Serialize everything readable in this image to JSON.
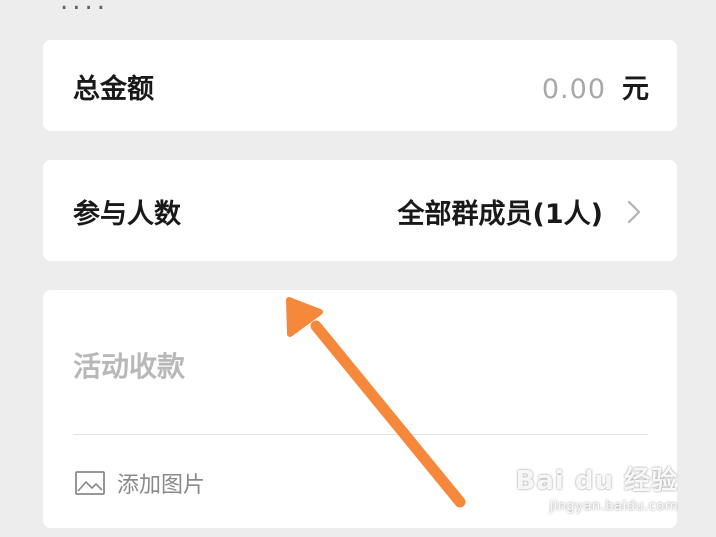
{
  "header": {
    "partial_title": "...."
  },
  "amount": {
    "label": "总金额",
    "value": "0.00",
    "unit": "元"
  },
  "participants": {
    "label": "参与人数",
    "value": "全部群成员(1人)"
  },
  "note": {
    "placeholder": "活动收款",
    "add_image_label": "添加图片"
  },
  "watermark": {
    "brand": "Bai du 经验",
    "url": "jingyan.baidu.com"
  },
  "colors": {
    "background": "#ededed",
    "card": "#ffffff",
    "arrow": "#f5883a",
    "placeholder": "#b8b8b8"
  }
}
